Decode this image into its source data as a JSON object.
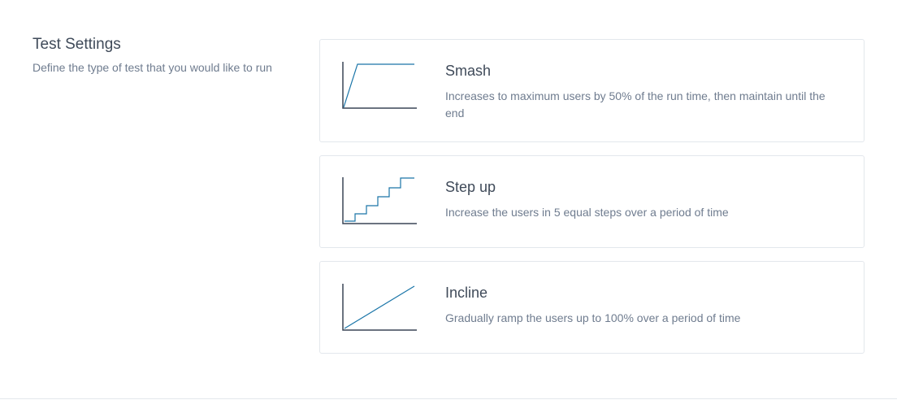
{
  "section": {
    "title": "Test Settings",
    "subtitle": "Define the type of test that you would like to run"
  },
  "options": [
    {
      "title": "Smash",
      "description": "Increases to maximum users by 50% of the run time, then maintain until the end",
      "icon": "smash-graph-icon"
    },
    {
      "title": "Step up",
      "description": "Increase the users in 5 equal steps over a period of time",
      "icon": "step-up-graph-icon"
    },
    {
      "title": "Incline",
      "description": "Gradually ramp the users up to 100% over a period of time",
      "icon": "incline-graph-icon"
    }
  ],
  "colors": {
    "axis": "#3a4556",
    "line": "#1a75a8",
    "border": "#e3e7ec",
    "title": "#3f4a59",
    "text": "#6f7c8f"
  }
}
